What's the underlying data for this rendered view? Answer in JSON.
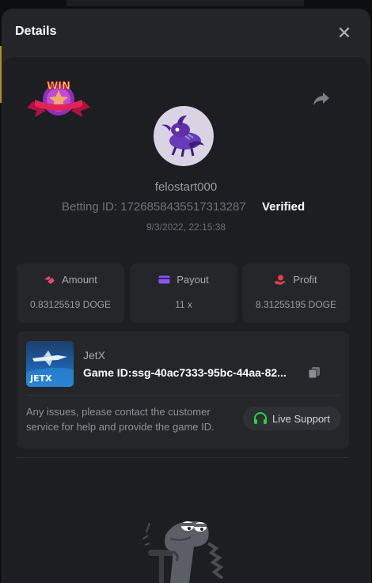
{
  "modal": {
    "title": "Details"
  },
  "player": {
    "username": "felostart000",
    "betting_id": "Betting ID: 1726858435517313287",
    "verified": "Verified",
    "date": "9/3/2022, 22:15:38"
  },
  "badge": {
    "text": "WIN"
  },
  "stats": [
    {
      "label": "Amount",
      "value": "0.83125519 DOGE",
      "icon": "amount-icon"
    },
    {
      "label": "Payout",
      "value": "11 x",
      "icon": "payout-icon"
    },
    {
      "label": "Profit",
      "value": "8.31255195 DOGE",
      "icon": "profit-icon"
    }
  ],
  "game": {
    "name": "JetX",
    "thumb_text": "JETX",
    "id": "Game ID:ssg-40ac7333-95bc-44aa-82...",
    "help": "Any issues, please contact the customer service for help and provide the game ID.",
    "support_label": "Live Support"
  },
  "colors": {
    "accent_green": "#2bd33f",
    "amount_pink": "#e8456b",
    "payout_purple": "#8b54f0",
    "profit_red": "#e43d4e"
  }
}
